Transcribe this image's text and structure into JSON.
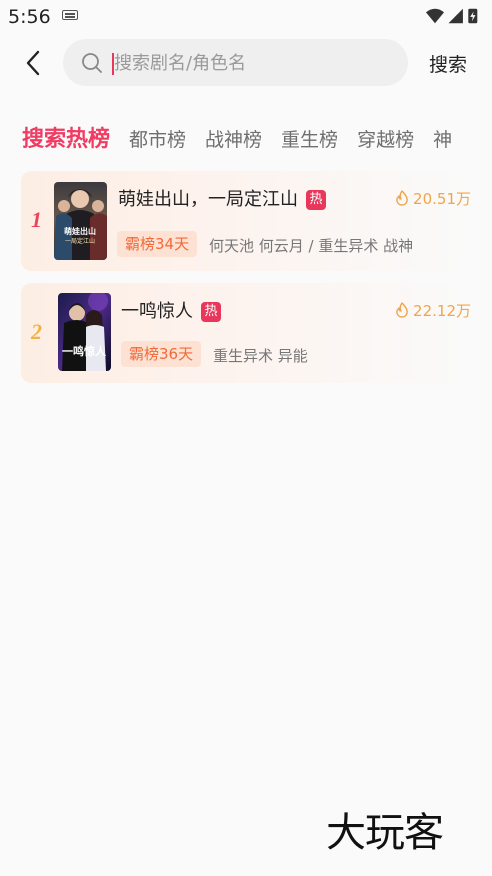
{
  "status_bar": {
    "time": "5:56"
  },
  "search": {
    "placeholder": "搜索剧名/角色名",
    "value": "",
    "button_label": "搜索"
  },
  "tabs": [
    "搜索热榜",
    "都市榜",
    "战神榜",
    "重生榜",
    "穿越榜",
    "神"
  ],
  "active_tab_index": 0,
  "items": [
    {
      "rank": "1",
      "title": "萌娃出山，一局定江山",
      "hot_badge": "热",
      "heat": "20.51万",
      "chip": "霸榜34天",
      "meta": "何天池 何云月 / 重生异术 战神",
      "poster_text": "萌娃出山"
    },
    {
      "rank": "2",
      "title": "一鸣惊人",
      "hot_badge": "热",
      "heat": "22.12万",
      "chip": "霸榜36天",
      "meta": "重生异术 异能",
      "poster_text": "一鸣惊人"
    }
  ],
  "watermark": "大玩客",
  "colors": {
    "accent": "#f03c63",
    "rank1": "#e8445c",
    "rank2": "#f0b34a",
    "heat": "#f0a54a",
    "chip_text": "#f26a3a",
    "chip_bg": "#fde1d2"
  }
}
